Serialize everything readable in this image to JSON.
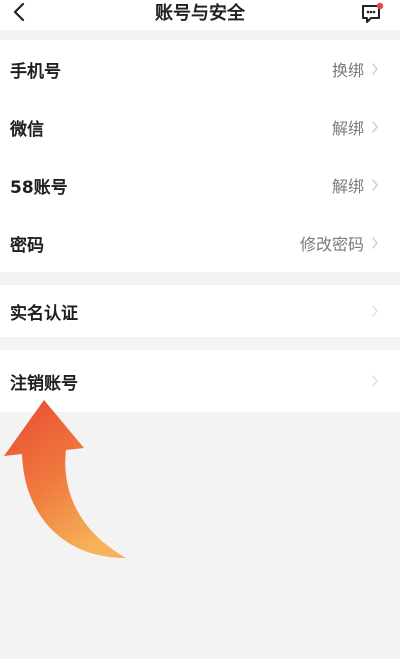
{
  "header": {
    "title": "账号与安全",
    "back_icon": "chevron-left-icon",
    "message_icon": "message-icon"
  },
  "groups": [
    {
      "items": [
        {
          "label": "手机号",
          "value": "换绑"
        },
        {
          "label": "微信",
          "value": "解绑"
        },
        {
          "label": "58账号",
          "value": "解绑"
        },
        {
          "label": "密码",
          "value": "修改密码"
        }
      ]
    },
    {
      "items": [
        {
          "label": "实名认证",
          "value": ""
        }
      ]
    },
    {
      "items": [
        {
          "label": "注销账号",
          "value": ""
        }
      ]
    }
  ],
  "colors": {
    "background": "#f3f3f3",
    "card": "#ffffff",
    "label": "#1f1f1f",
    "value": "#7a7a7a",
    "chevron": "#cfcfcf",
    "badge": "#e5484d",
    "arrow_top": "#e84a32",
    "arrow_bottom": "#f6b25a"
  }
}
